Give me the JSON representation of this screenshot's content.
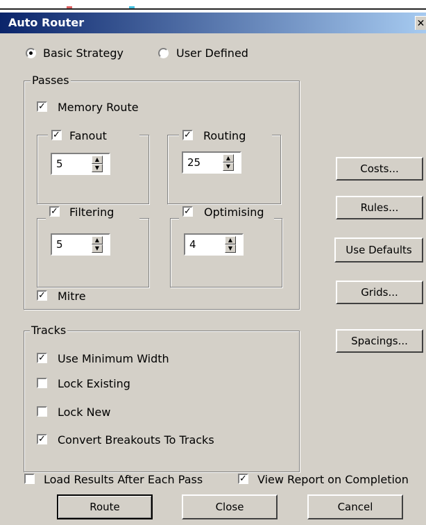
{
  "window": {
    "title": "Auto Router",
    "close_glyph": "✕"
  },
  "strategy": {
    "basic": {
      "label": "Basic Strategy",
      "selected": true
    },
    "user": {
      "label": "User Defined",
      "selected": false
    }
  },
  "passes": {
    "title": "Passes",
    "memory_route": {
      "label": "Memory Route",
      "checked": true
    },
    "fanout": {
      "label": "Fanout",
      "checked": true,
      "value": "5"
    },
    "routing": {
      "label": "Routing",
      "checked": true,
      "value": "25"
    },
    "filtering": {
      "label": "Filtering",
      "checked": true,
      "value": "5"
    },
    "optimising": {
      "label": "Optimising",
      "checked": true,
      "value": "4"
    },
    "mitre": {
      "label": "Mitre",
      "checked": true
    }
  },
  "tracks": {
    "title": "Tracks",
    "use_min_width": {
      "label": "Use Minimum Width",
      "checked": true
    },
    "lock_existing": {
      "label": "Lock Existing",
      "checked": false
    },
    "lock_new": {
      "label": "Lock New",
      "checked": false
    },
    "convert_breakouts": {
      "label": "Convert Breakouts To Tracks",
      "checked": true
    }
  },
  "side_buttons": {
    "costs": "Costs...",
    "rules": "Rules...",
    "use_defaults": "Use Defaults",
    "grids": "Grids...",
    "spacings": "Spacings..."
  },
  "options": {
    "load_results": {
      "label": "Load Results After Each Pass",
      "checked": false
    },
    "view_report": {
      "label": "View Report on Completion",
      "checked": true
    }
  },
  "footer": {
    "route": "Route",
    "close": "Close",
    "cancel": "Cancel"
  },
  "check_glyph": "✓"
}
